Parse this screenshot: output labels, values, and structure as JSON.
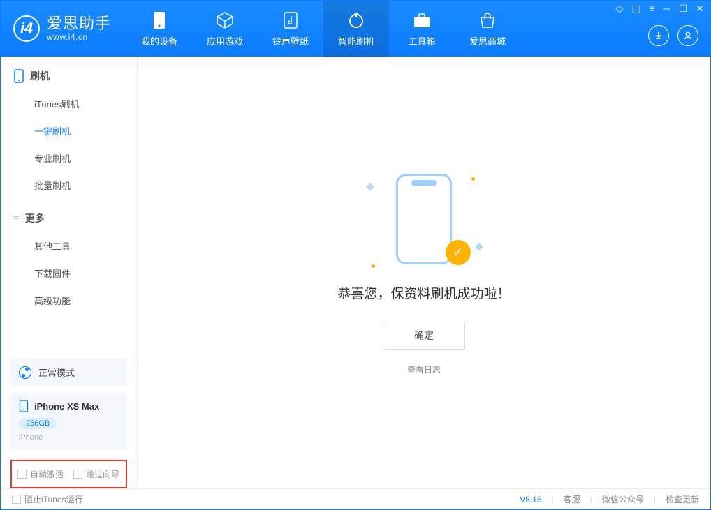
{
  "app": {
    "name": "爱思助手",
    "url": "www.i4.cn"
  },
  "nav": {
    "items": [
      {
        "label": "我的设备"
      },
      {
        "label": "应用游戏"
      },
      {
        "label": "铃声壁纸"
      },
      {
        "label": "智能刷机"
      },
      {
        "label": "工具箱"
      },
      {
        "label": "爱思商城"
      }
    ]
  },
  "sidebar": {
    "group1": {
      "title": "刷机",
      "items": [
        {
          "label": "iTunes刷机"
        },
        {
          "label": "一键刷机"
        },
        {
          "label": "专业刷机"
        },
        {
          "label": "批量刷机"
        }
      ]
    },
    "group2": {
      "title": "更多",
      "items": [
        {
          "label": "其他工具"
        },
        {
          "label": "下载固件"
        },
        {
          "label": "高级功能"
        }
      ]
    },
    "mode": "正常模式",
    "device": {
      "name": "iPhone XS Max",
      "capacity": "256GB",
      "type": "iPhone"
    },
    "check1": "自动激活",
    "check2": "跳过向导"
  },
  "main": {
    "message": "恭喜您，保资料刷机成功啦！",
    "ok": "确定",
    "viewlog": "查看日志"
  },
  "statusbar": {
    "block_itunes": "阻止iTunes运行",
    "version": "V8.16",
    "links": [
      "客服",
      "微信公众号",
      "检查更新"
    ]
  }
}
